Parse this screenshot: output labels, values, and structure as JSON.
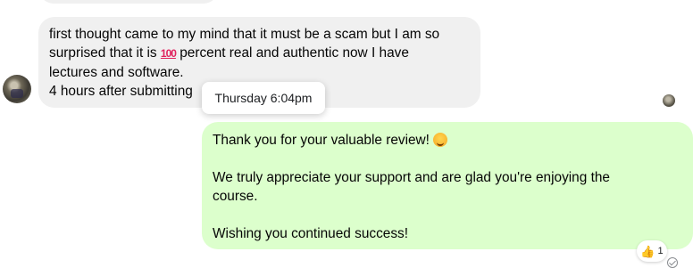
{
  "incoming_message": {
    "line1": "first thought came to my mind that it must be a scam but I am so",
    "line2_before": "surprised that it is ",
    "line2_emoji": "100",
    "line2_after": " percent real and authentic now I have",
    "line3": "lectures and software.",
    "line4": "4 hours after submitting"
  },
  "timestamp_tooltip": "Thursday 6:04pm",
  "outgoing_message": {
    "paragraph1": "Thank you for your valuable review! ",
    "paragraph1_emoji": "smiling-face-icon",
    "paragraph2_line1": "We truly appreciate your support and are glad you're enjoying the",
    "paragraph2_line2": "course.",
    "paragraph3": "Wishing you continued success!"
  },
  "reaction": {
    "emoji": "thumbs-up-icon",
    "count": "1"
  },
  "colors": {
    "incoming_bubble": "#f0f0f0",
    "outgoing_bubble": "#dcffcc"
  }
}
